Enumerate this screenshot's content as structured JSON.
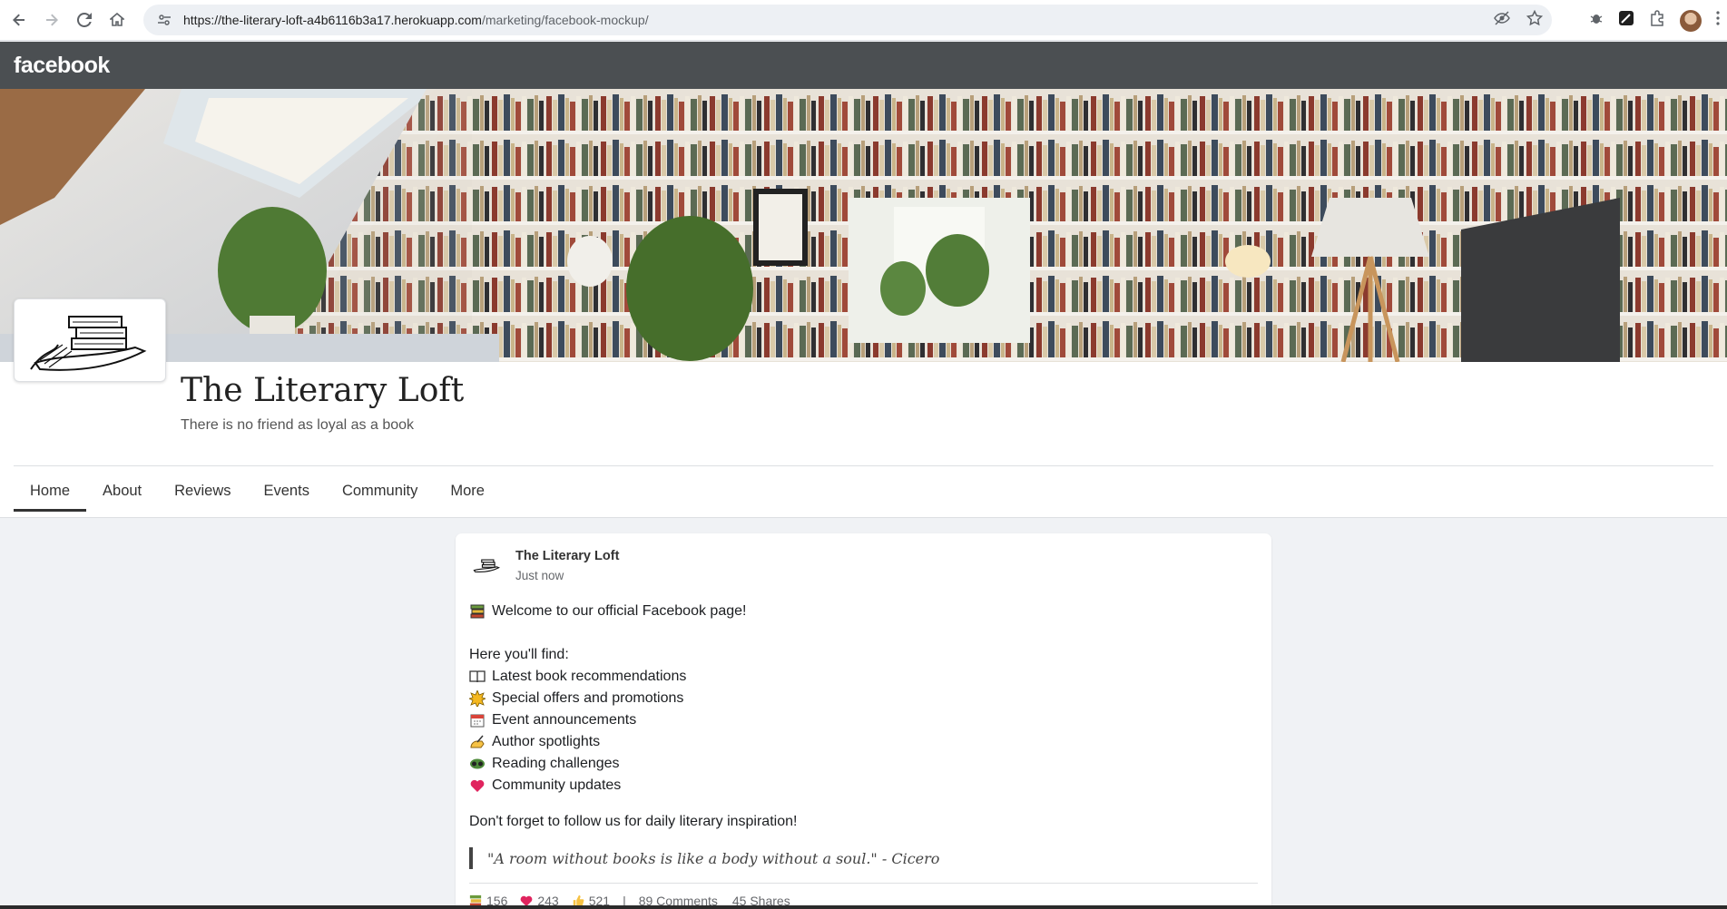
{
  "browser": {
    "url_main": "https://the-literary-loft-a4b6116b3a17.herokuapp.com",
    "url_path": "/marketing/facebook-mockup/"
  },
  "fb": {
    "logo": "facebook"
  },
  "page": {
    "name": "The Literary Loft",
    "tagline": "There is no friend as loyal as a book"
  },
  "tabs": [
    {
      "label": "Home",
      "active": true
    },
    {
      "label": "About"
    },
    {
      "label": "Reviews"
    },
    {
      "label": "Events"
    },
    {
      "label": "Community"
    },
    {
      "label": "More"
    }
  ],
  "post": {
    "author": "The Literary Loft",
    "time": "Just now",
    "welcome": "Welcome to our official Facebook page!",
    "find_heading": "Here you'll find:",
    "items": [
      {
        "icon": "open-book-icon",
        "text": "Latest book recommendations"
      },
      {
        "icon": "sparkle-icon",
        "text": "Special offers and promotions"
      },
      {
        "icon": "calendar-icon",
        "text": "Event announcements"
      },
      {
        "icon": "writing-hand-icon",
        "text": "Author spotlights"
      },
      {
        "icon": "reading-glasses-icon",
        "text": "Reading challenges"
      },
      {
        "icon": "heart-icon",
        "text": "Community updates"
      }
    ],
    "follow": "Don't forget to follow us for daily literary inspiration!",
    "quote": "\"A room without books is like a body without a soul.\" - Cicero",
    "stats": {
      "books": "156",
      "hearts": "243",
      "likes": "521",
      "separator": "|",
      "comments": "89 Comments",
      "shares": "45 Shares"
    }
  },
  "colors": {
    "fb_bar": "#4b4f52",
    "page_bg": "#f0f2f5",
    "card_bg": "#ffffff",
    "heart": "#e0245e"
  }
}
